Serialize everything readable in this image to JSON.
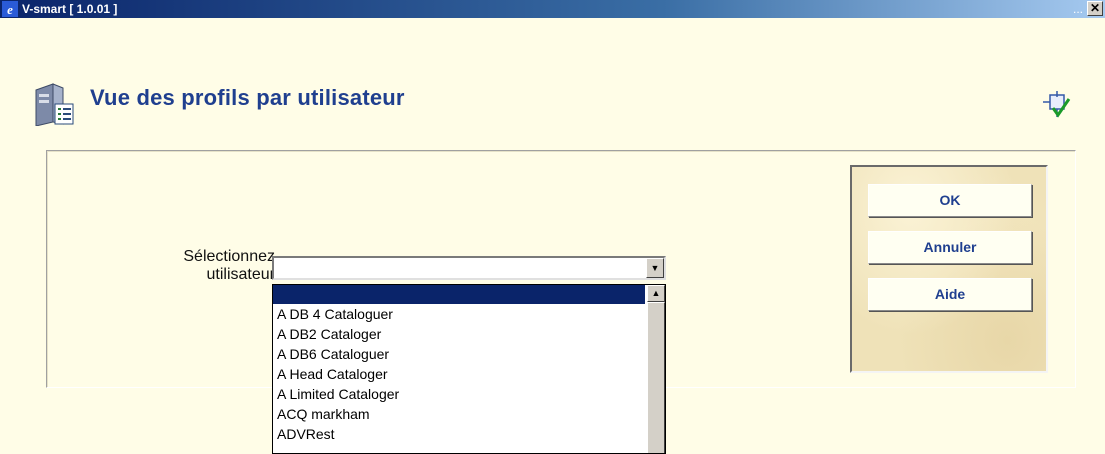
{
  "window": {
    "title": "V-smart [ 1.0.01 ]",
    "dots": "...",
    "close_glyph": "✕"
  },
  "page": {
    "title": "Vue des profils par utilisateur"
  },
  "form": {
    "label_line1": "Sélectionnez",
    "label_line2": "utilisateur",
    "select_value": ""
  },
  "dropdown": {
    "items": [
      "",
      "A DB 4 Cataloguer",
      "A DB2 Cataloger",
      "A DB6 Cataloguer",
      "A Head Cataloger",
      "A Limited Cataloger",
      "ACQ markham",
      "ADVRest"
    ],
    "selected_index": 0
  },
  "buttons": {
    "ok": "OK",
    "cancel": "Annuler",
    "help": "Aide"
  },
  "colors": {
    "title_blue": "#1f3f8f",
    "background": "#fffde7",
    "selection": "#0a246a"
  }
}
